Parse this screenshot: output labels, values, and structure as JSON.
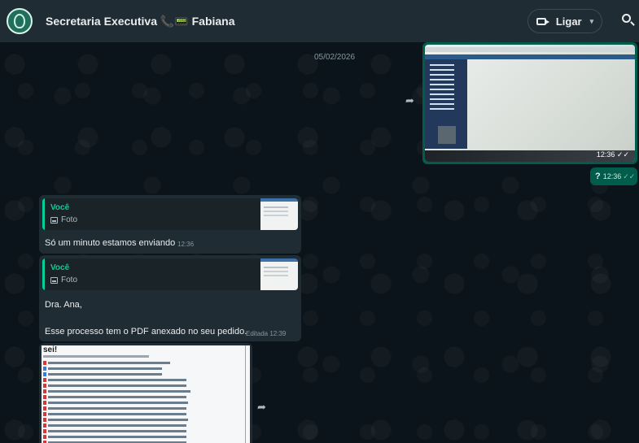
{
  "header": {
    "chat_title": "Secretaria Executiva 📞📟 Fabiana",
    "call_label": "Ligar"
  },
  "chat": {
    "date_separator": "05/02/2026",
    "outgoing": [
      {
        "type": "image",
        "time": "12:36"
      },
      {
        "type": "text",
        "text": "?",
        "time": "12:36"
      }
    ],
    "incoming": [
      {
        "quote_author": "Você",
        "quote_kind": "Foto",
        "text": "Só um minuto estamos enviando",
        "time": "12:36"
      },
      {
        "quote_author": "Você",
        "quote_kind": "Foto",
        "line1": "Dra. Ana,",
        "line2": "Esse processo tem o PDF anexado no seu pedido.",
        "time": "Editada 12:39"
      },
      {
        "type": "image",
        "logo_text": "sei!"
      }
    ]
  }
}
